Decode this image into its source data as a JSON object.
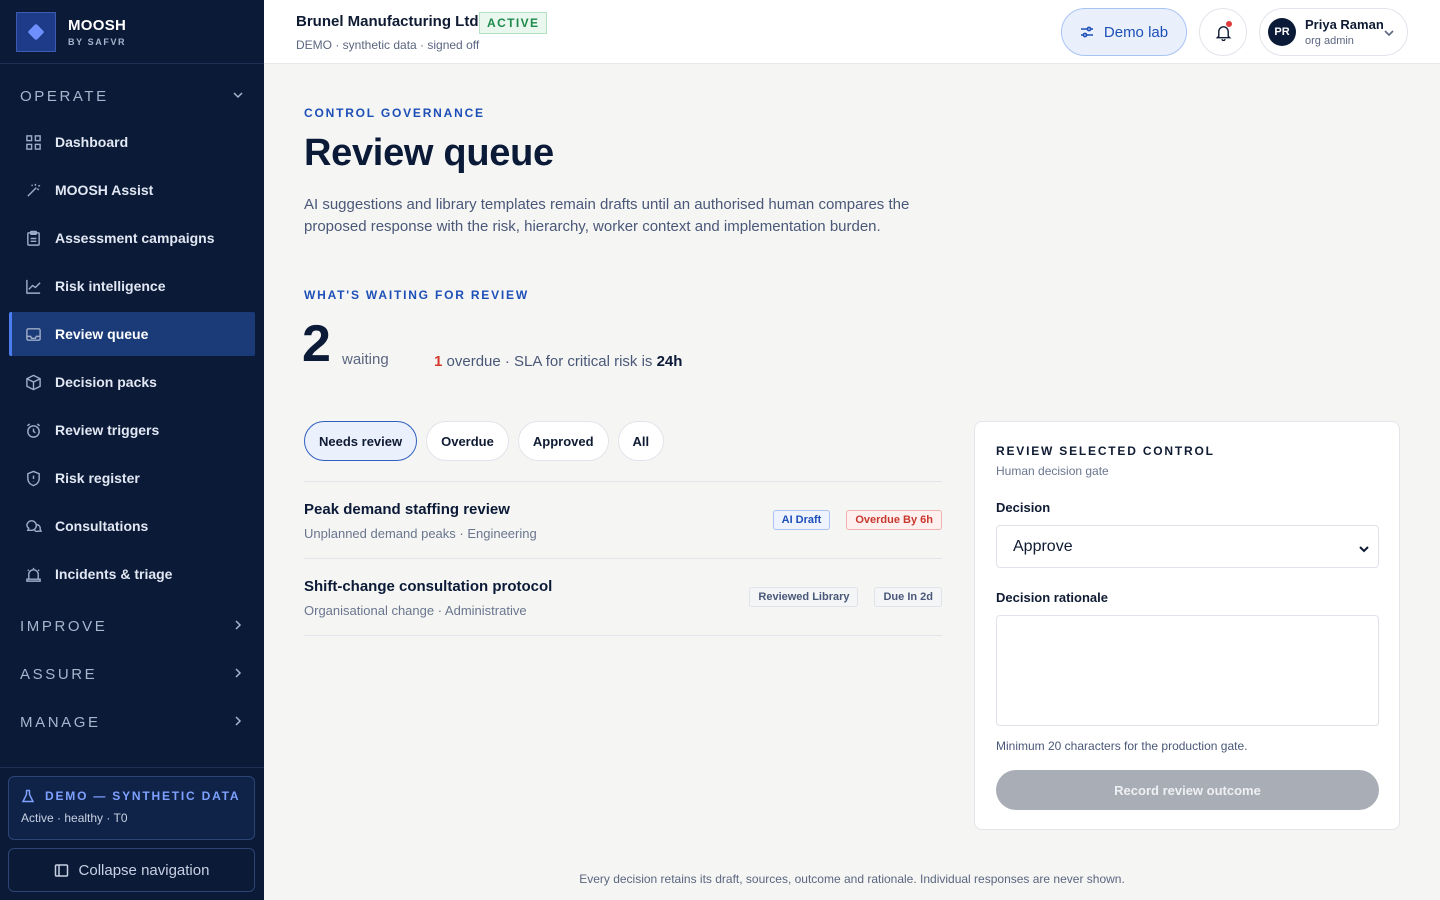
{
  "brand": {
    "name": "MOOSH",
    "sub": "BY SAFVR"
  },
  "sidebar": {
    "operate": {
      "label": "OPERATE"
    },
    "items": [
      {
        "label": "Dashboard",
        "icon": "grid-icon"
      },
      {
        "label": "MOOSH Assist",
        "icon": "magic-wand-icon"
      },
      {
        "label": "Assessment campaigns",
        "icon": "clipboard-icon"
      },
      {
        "label": "Risk intelligence",
        "icon": "line-chart-icon"
      },
      {
        "label": "Review queue",
        "icon": "inbox-icon",
        "active": true
      },
      {
        "label": "Decision packs",
        "icon": "package-icon"
      },
      {
        "label": "Review triggers",
        "icon": "alarm-clock-icon"
      },
      {
        "label": "Risk register",
        "icon": "shield-icon"
      },
      {
        "label": "Consultations",
        "icon": "chat-bubbles-icon"
      },
      {
        "label": "Incidents & triage",
        "icon": "siren-icon"
      }
    ],
    "sections": [
      {
        "label": "IMPROVE"
      },
      {
        "label": "ASSURE"
      },
      {
        "label": "MANAGE"
      }
    ],
    "demo": {
      "title": "DEMO — SYNTHETIC DATA",
      "status": "Active · healthy · T0"
    },
    "collapse_label": "Collapse navigation"
  },
  "header": {
    "org_name": "Brunel Manufacturing Ltd",
    "org_status": "ACTIVE",
    "org_sub": "DEMO · synthetic data · signed off",
    "demo_lab_label": "Demo lab",
    "user": {
      "initials": "PR",
      "name": "Priya Raman",
      "role": "org admin"
    }
  },
  "main": {
    "eyebrow": "CONTROL GOVERNANCE",
    "title": "Review queue",
    "description": "AI suggestions and library templates remain drafts until an authorised human compares the proposed response with the risk, hierarchy, worker context and implementation burden.",
    "waiting_eyebrow": "WHAT'S WAITING FOR REVIEW",
    "waiting_count": "2",
    "waiting_label": "waiting",
    "overdue_count": "1",
    "overdue_text": " overdue · SLA for critical risk is ",
    "sla_value": "24h",
    "filters": [
      {
        "label": "Needs review",
        "active": true
      },
      {
        "label": "Overdue"
      },
      {
        "label": "Approved"
      },
      {
        "label": "All"
      }
    ],
    "rows": [
      {
        "title": "Peak demand staffing review",
        "sub": "Unplanned demand peaks · Engineering",
        "tag1": "AI Draft",
        "tag2": "Overdue By 6h"
      },
      {
        "title": "Shift-change consultation protocol",
        "sub": "Organisational change · Administrative",
        "tag1": "Reviewed Library",
        "tag2": "Due In 2d"
      }
    ]
  },
  "panel": {
    "title": "REVIEW SELECTED CONTROL",
    "sub": "Human decision gate",
    "decision_label": "Decision",
    "decision_value": "Approve",
    "rationale_label": "Decision rationale",
    "rationale_value": "",
    "hint": "Minimum 20 characters for the production gate.",
    "record_label": "Record review outcome"
  },
  "footer": "Every decision retains its draft, sources, outcome and rationale. Individual responses are never shown."
}
